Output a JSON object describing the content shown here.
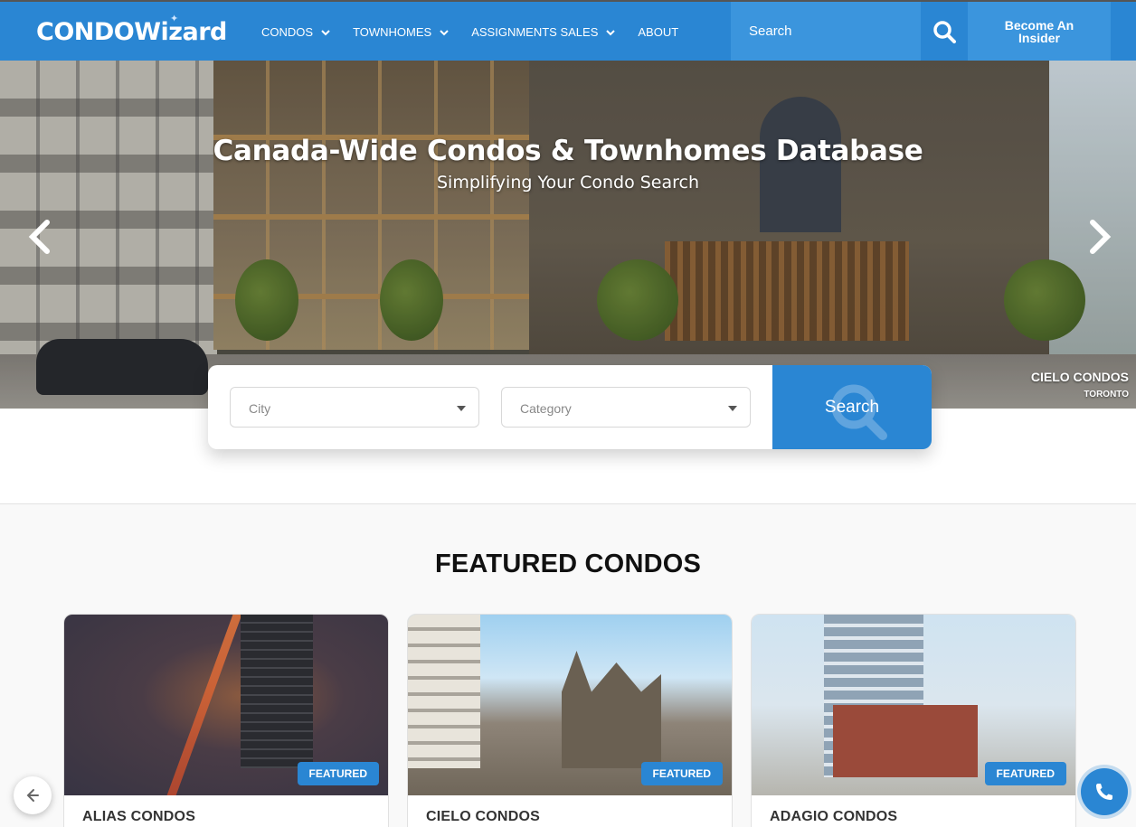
{
  "brand": {
    "logo_text": "CONDOWizard"
  },
  "nav": {
    "items": [
      {
        "label": "CONDOS",
        "has_dropdown": true
      },
      {
        "label": "TOWNHOMES",
        "has_dropdown": true
      },
      {
        "label": "ASSIGNMENTS SALES",
        "has_dropdown": true
      },
      {
        "label": "ABOUT",
        "has_dropdown": false
      }
    ],
    "search_placeholder": "Search",
    "search_icon": "search-icon",
    "cta_label": "Become An Insider"
  },
  "hero": {
    "title": "Canada-Wide Condos & Townhomes Database",
    "subtitle": "Simplifying Your Condo Search",
    "caption_name": "CIELO CONDOS",
    "caption_city": "TORONTO",
    "prev_icon": "chevron-left-icon",
    "next_icon": "chevron-right-icon"
  },
  "search_panel": {
    "city_placeholder": "City",
    "category_placeholder": "Category",
    "button_label": "Search"
  },
  "featured": {
    "title": "FEATURED CONDOS",
    "cards": [
      {
        "name": "ALIAS CONDOS",
        "badge": "FEATURED"
      },
      {
        "name": "CIELO CONDOS",
        "badge": "FEATURED"
      },
      {
        "name": "ADAGIO CONDOS",
        "badge": "FEATURED"
      }
    ]
  },
  "colors": {
    "primary": "#2a86d3",
    "primary_light": "#3b95dd"
  }
}
